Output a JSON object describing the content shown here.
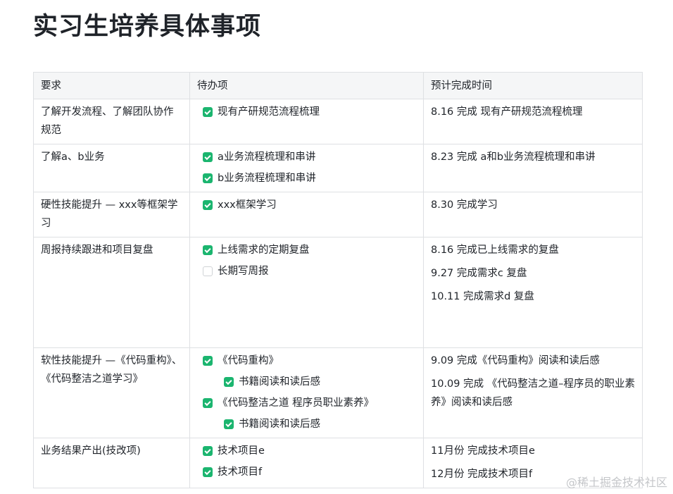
{
  "title": "实习生培养具体事项",
  "headers": [
    "要求",
    "待办项",
    "预计完成时间"
  ],
  "rows": [
    {
      "req": "了解开发流程、了解团队协作规范",
      "todos": [
        {
          "text": "现有产研规范流程梳理",
          "checked": true,
          "level": 0
        }
      ],
      "times": [
        "8.16 完成 现有产研规范流程梳理"
      ]
    },
    {
      "req": "了解a、b业务",
      "todos": [
        {
          "text": "a业务流程梳理和串讲",
          "checked": true,
          "level": 0
        },
        {
          "text": "b业务流程梳理和串讲",
          "checked": true,
          "level": 0
        }
      ],
      "times": [
        "8.23 完成 a和b业务流程梳理和串讲"
      ]
    },
    {
      "req": "硬性技能提升 — xxx等框架学习",
      "todos": [
        {
          "text": "xxx框架学习",
          "checked": true,
          "level": 0
        }
      ],
      "times": [
        "8.30 完成学习"
      ]
    },
    {
      "req": "周报持续跟进和项目复盘",
      "todos": [
        {
          "text": "上线需求的定期复盘",
          "checked": true,
          "level": 0
        },
        {
          "text": "长期写周报",
          "checked": false,
          "level": 0
        }
      ],
      "times": [
        "8.16 完成已上线需求的复盘",
        "9.27 完成需求c 复盘",
        "10.11 完成需求d 复盘"
      ]
    },
    {
      "req": "软性技能提升 —《代码重构》、《代码整洁之道学习》",
      "todos": [
        {
          "text": "《代码重构》",
          "checked": true,
          "level": 0
        },
        {
          "text": "书籍阅读和读后感",
          "checked": true,
          "level": 1
        },
        {
          "text": "《代码整洁之道 程序员职业素养》",
          "checked": true,
          "level": 0
        },
        {
          "text": "书籍阅读和读后感",
          "checked": true,
          "level": 1
        }
      ],
      "times": [
        "9.09 完成《代码重构》阅读和读后感",
        "10.09 完成 《代码整洁之道–程序员的职业素养》阅读和读后感"
      ]
    },
    {
      "req": "业务结果产出(技改项)",
      "todos": [
        {
          "text": "技术项目e",
          "checked": true,
          "level": 0
        },
        {
          "text": "技术项目f",
          "checked": true,
          "level": 0
        }
      ],
      "times": [
        "11月份 完成技术项目e",
        "12月份 完成技术项目f"
      ]
    }
  ],
  "colors": {
    "checkbox_checked": "#1bb56f",
    "header_bg": "#f5f6f7",
    "border": "#dee0e3"
  },
  "watermark": "@稀土掘金技术社区"
}
